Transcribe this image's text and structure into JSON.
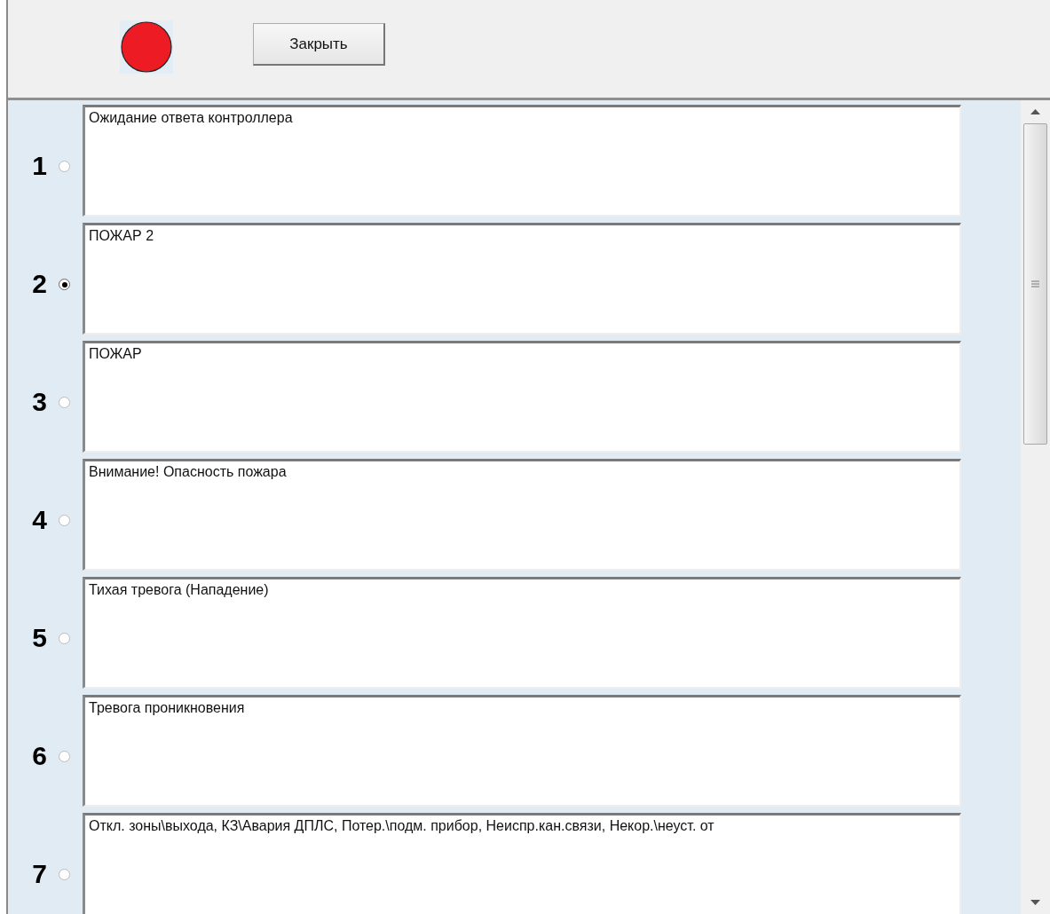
{
  "toolbar": {
    "indicator": {
      "color": "#ed1c24"
    },
    "close_button": "Закрыть"
  },
  "rows": [
    {
      "number": "1",
      "selected": false,
      "text": "Ожидание ответа контроллера"
    },
    {
      "number": "2",
      "selected": true,
      "text": "ПОЖАР 2"
    },
    {
      "number": "3",
      "selected": false,
      "text": "ПОЖАР"
    },
    {
      "number": "4",
      "selected": false,
      "text": "Внимание! Опасность пожара"
    },
    {
      "number": "5",
      "selected": false,
      "text": "Тихая тревога (Нападение)"
    },
    {
      "number": "6",
      "selected": false,
      "text": "Тревога проникновения"
    },
    {
      "number": "7",
      "selected": false,
      "text": "Откл. зоны\\выхода, КЗ\\Авария ДПЛС, Потер.\\подм. прибор, Неиспр.кан.связи, Некор.\\неуст. от"
    }
  ]
}
